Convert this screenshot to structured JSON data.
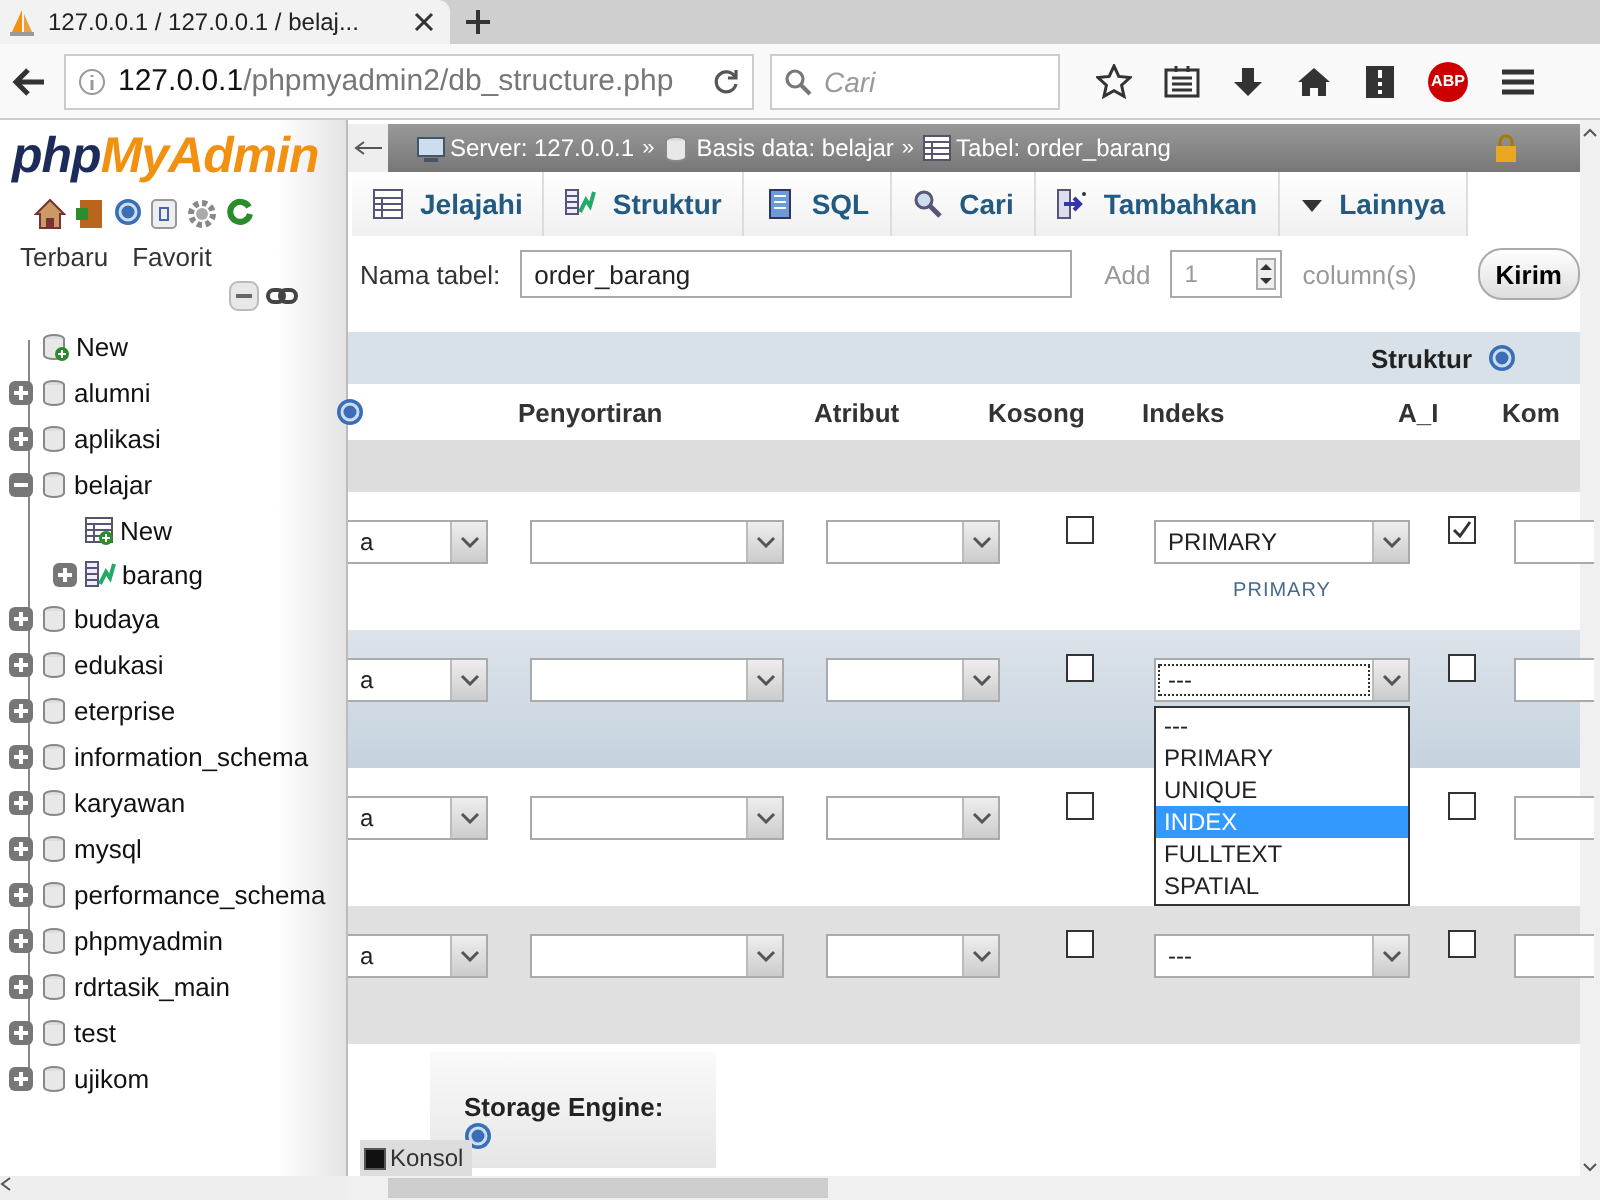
{
  "browser": {
    "tab_title": "127.0.0.1 / 127.0.0.1 / belaj...",
    "address_host": "127.0.0.1",
    "address_path": "/phpmyadmin2/db_structure.php",
    "search_placeholder": "Cari",
    "adblock_badge": "ABP"
  },
  "sidebar": {
    "logo": {
      "part_1": "php",
      "part_2": "MyAdmin"
    },
    "links": [
      "Terbaru",
      "Favorit"
    ],
    "tree": [
      {
        "label": "New",
        "kind": "new_db"
      },
      {
        "label": "alumni",
        "kind": "database",
        "expanded": false
      },
      {
        "label": "aplikasi",
        "kind": "database",
        "expanded": false
      },
      {
        "label": "belajar",
        "kind": "database",
        "expanded": true,
        "children": [
          {
            "label": "New",
            "kind": "new_table"
          },
          {
            "label": "barang",
            "kind": "table",
            "expanded": false
          }
        ]
      },
      {
        "label": "budaya",
        "kind": "database",
        "expanded": false
      },
      {
        "label": "edukasi",
        "kind": "database",
        "expanded": false
      },
      {
        "label": "eterprise",
        "kind": "database",
        "expanded": false
      },
      {
        "label": "information_schema",
        "kind": "database",
        "expanded": false
      },
      {
        "label": "karyawan",
        "kind": "database",
        "expanded": false
      },
      {
        "label": "mysql",
        "kind": "database",
        "expanded": false
      },
      {
        "label": "performance_schema",
        "kind": "database",
        "expanded": false
      },
      {
        "label": "phpmyadmin",
        "kind": "database",
        "expanded": false
      },
      {
        "label": "rdrtasik_main",
        "kind": "database",
        "expanded": false
      },
      {
        "label": "test",
        "kind": "database",
        "expanded": false
      },
      {
        "label": "ujikom",
        "kind": "database",
        "expanded": false
      }
    ]
  },
  "main": {
    "breadcrumb": [
      {
        "label": "Server: 127.0.0.1",
        "kind": "server"
      },
      {
        "label": "Basis data: belajar",
        "kind": "database"
      },
      {
        "label": "Tabel: order_barang",
        "kind": "table"
      }
    ],
    "separator": "»",
    "tabs": [
      {
        "label": "Jelajahi",
        "kind": "browse",
        "selected": false
      },
      {
        "label": "Struktur",
        "kind": "structure",
        "selected": false
      },
      {
        "label": "SQL",
        "kind": "sql",
        "selected": false
      },
      {
        "label": "Cari",
        "kind": "search",
        "selected": false
      },
      {
        "label": "Tambahkan",
        "kind": "insert",
        "selected": false
      },
      {
        "label": "Lainnya",
        "kind": "more",
        "selected": false
      }
    ],
    "table_name": {
      "label": "Nama tabel:",
      "value": "order_barang"
    },
    "add_columns": {
      "label": "Add",
      "value": "1",
      "unit": "column(s)",
      "button": "Kirim"
    },
    "section_title": "Struktur",
    "columns": [
      "Penyortiran",
      "Atribut",
      "Kosong",
      "Indeks",
      "A_I",
      "Kom"
    ],
    "rows": [
      {
        "type": "a",
        "null": false,
        "index": "PRIMARY",
        "index_note": "PRIMARY",
        "auto_increment": true,
        "highlighted": false
      },
      {
        "type": "a",
        "null": false,
        "index": "---",
        "auto_increment": false,
        "highlighted": true,
        "options": [
          {
            "label": "---",
            "selected": false
          },
          {
            "label": "PRIMARY",
            "selected": false
          },
          {
            "label": "UNIQUE",
            "selected": false
          },
          {
            "label": "INDEX",
            "selected": true
          },
          {
            "label": "FULLTEXT",
            "selected": false
          },
          {
            "label": "SPATIAL",
            "selected": false
          }
        ]
      },
      {
        "type": "a",
        "null": false,
        "auto_increment": false,
        "highlighted": false
      },
      {
        "type": "a",
        "null": false,
        "index": "---",
        "auto_increment": false,
        "highlighted": false
      }
    ],
    "storage_label": "Storage Engine:",
    "console": "Konsol"
  }
}
